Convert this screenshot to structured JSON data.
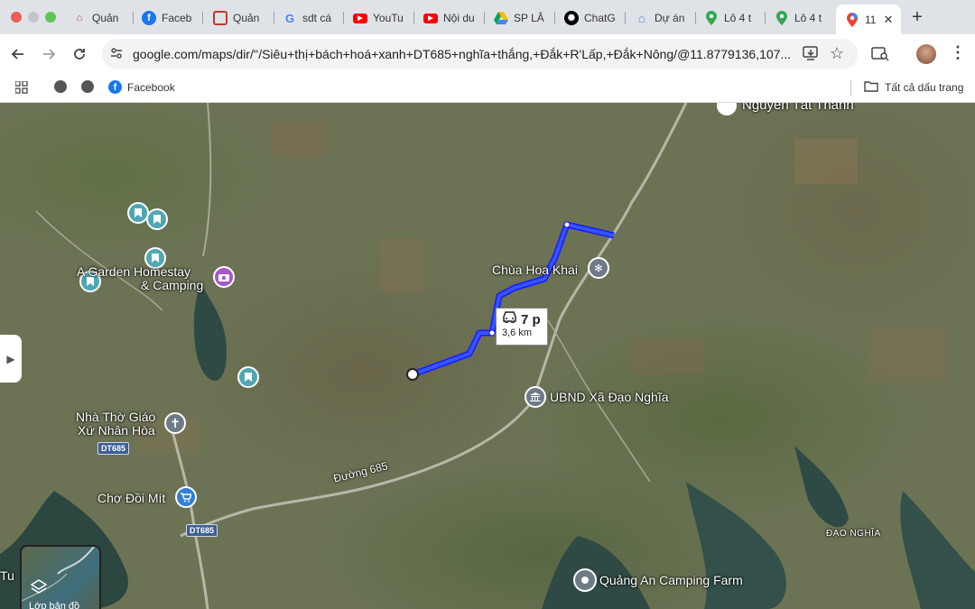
{
  "tabs": [
    {
      "label": "Quản",
      "icon": "house-icon"
    },
    {
      "label": "Faceb",
      "icon": "facebook-icon"
    },
    {
      "label": "Quản",
      "icon": "window-icon"
    },
    {
      "label": "sdt cá",
      "icon": "google-icon"
    },
    {
      "label": "YouTu",
      "icon": "youtube-icon"
    },
    {
      "label": "Nội du",
      "icon": "youtube-icon"
    },
    {
      "label": "SP LÂ",
      "icon": "drive-icon"
    },
    {
      "label": "ChatG",
      "icon": "chatgpt-icon"
    },
    {
      "label": "Dự án",
      "icon": "house-icon"
    },
    {
      "label": "Lô 4 t",
      "icon": "maps-icon"
    },
    {
      "label": "Lô 4 t",
      "icon": "maps-icon"
    },
    {
      "label": "11",
      "icon": "maps-icon",
      "active": true
    }
  ],
  "toolbar": {
    "url_host": "google.com",
    "url_rest": "/maps/dir/''/Siêu+thị+bách+hoá+xanh+DT685+nghĩa+thắng,+Đắk+R'Lấp,+Đắk+Nông/@11.8779136,107...."
  },
  "bookmarks": {
    "items": [
      {
        "label": "",
        "icon": "globe-icon"
      },
      {
        "label": "",
        "icon": "globe-icon"
      },
      {
        "label": "Facebook",
        "icon": "facebook-icon"
      }
    ],
    "all_bookmarks": "Tất cả dấu trang"
  },
  "map": {
    "labels": {
      "nguyen_tat_thanh": "Nguyễn Tất Thành",
      "homestay": "A Garden Homestay",
      "homestay2": "& Camping",
      "chua": "Chùa Hoa Khai",
      "ubnd": "UBND Xã Đạo Nghĩa",
      "nhatho1": "Nhà Thờ Giáo",
      "nhatho2": "Xứ Nhân Hòa",
      "cho": "Chợ Đồi Mít",
      "duong": "Đường 685",
      "dao_nghia": "ĐẠO NGHĨA",
      "quang_an": "Quảng An Camping Farm",
      "tu": "Tu"
    },
    "road_badges": [
      "DT685",
      "DT685"
    ],
    "route": {
      "time": "7 p",
      "distance": "3,6 km"
    },
    "layers_label": "Lớp bản đồ"
  }
}
